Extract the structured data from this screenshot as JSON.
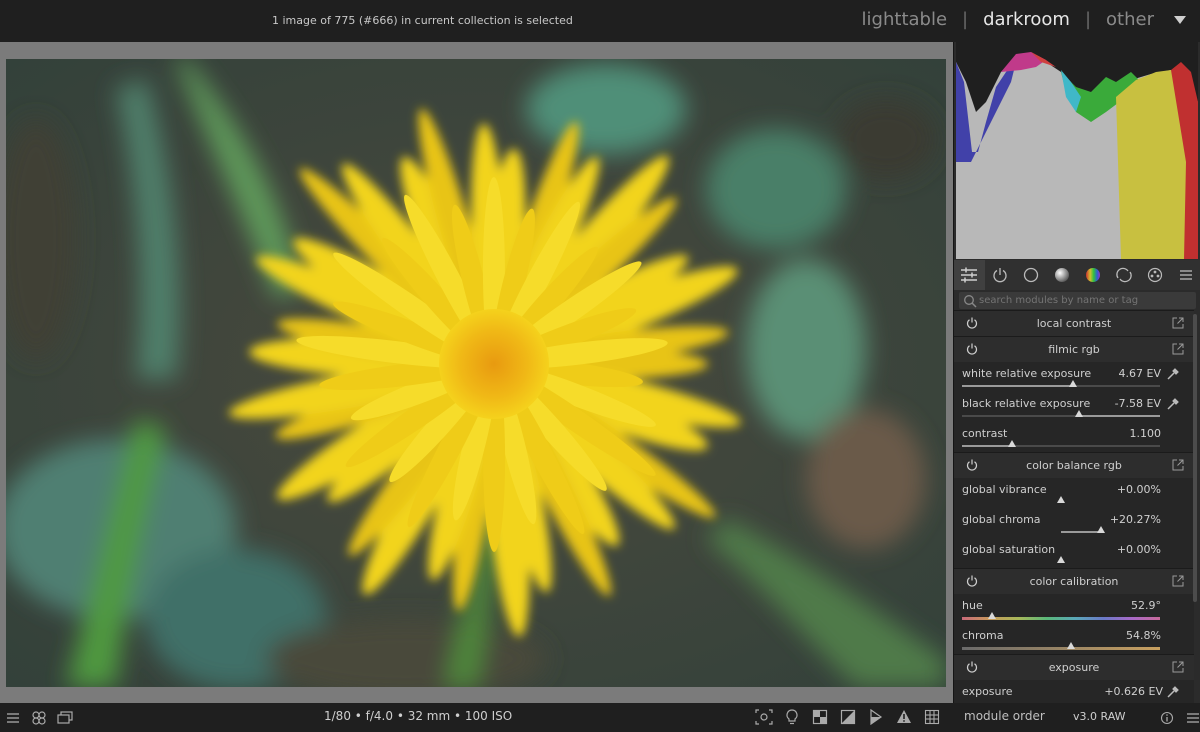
{
  "topbar": {
    "status": "1 image of 775 (#666) in current collection is selected",
    "views": [
      {
        "label": "lighttable",
        "active": false
      },
      {
        "label": "darkroom",
        "active": true
      },
      {
        "label": "other",
        "active": false
      }
    ],
    "separator": "|"
  },
  "rightpanel": {
    "search_placeholder": "search modules by name or tag",
    "tabs": [
      "active-modules-icon",
      "power-icon",
      "circle-icon",
      "sphere-icon",
      "color-icon",
      "correct-icon",
      "effect-icon",
      "menu-icon"
    ],
    "modules": {
      "local_contrast": {
        "title": "local contrast"
      },
      "filmic": {
        "title": "filmic rgb",
        "white_label": "white relative exposure",
        "white_value": "4.67 EV",
        "white_pos": 0.56,
        "black_label": "black relative exposure",
        "black_value": "-7.58 EV",
        "black_pos": 0.59,
        "contrast_label": "contrast",
        "contrast_value": "1.100",
        "contrast_pos": 0.25
      },
      "color_balance": {
        "title": "color balance rgb",
        "vibrance_label": "global vibrance",
        "vibrance_value": "+0.00%",
        "vibrance_pos": 0.5,
        "chroma_label": "global chroma",
        "chroma_value": "+20.27%",
        "chroma_pos": 0.7,
        "saturation_label": "global saturation",
        "saturation_value": "+0.00%",
        "saturation_pos": 0.5
      },
      "calibration": {
        "title": "color calibration",
        "hue_label": "hue",
        "hue_value": "52.9°",
        "hue_pos": 0.15,
        "chroma_label": "chroma",
        "chroma_value": "54.8%",
        "chroma_pos": 0.55
      },
      "exposure": {
        "title": "exposure",
        "exposure_label": "exposure",
        "exposure_value": "+0.626 EV"
      }
    }
  },
  "bottombar": {
    "exif": "1/80 • f/4.0 • 32 mm • 100 ISO",
    "module_order_label": "module order",
    "module_order_value": "v3.0 RAW"
  },
  "colors": {
    "accent_active": "#e6e6e6",
    "panel_bg": "#2b2b2b",
    "flower_yellow": "#f2d41b"
  }
}
